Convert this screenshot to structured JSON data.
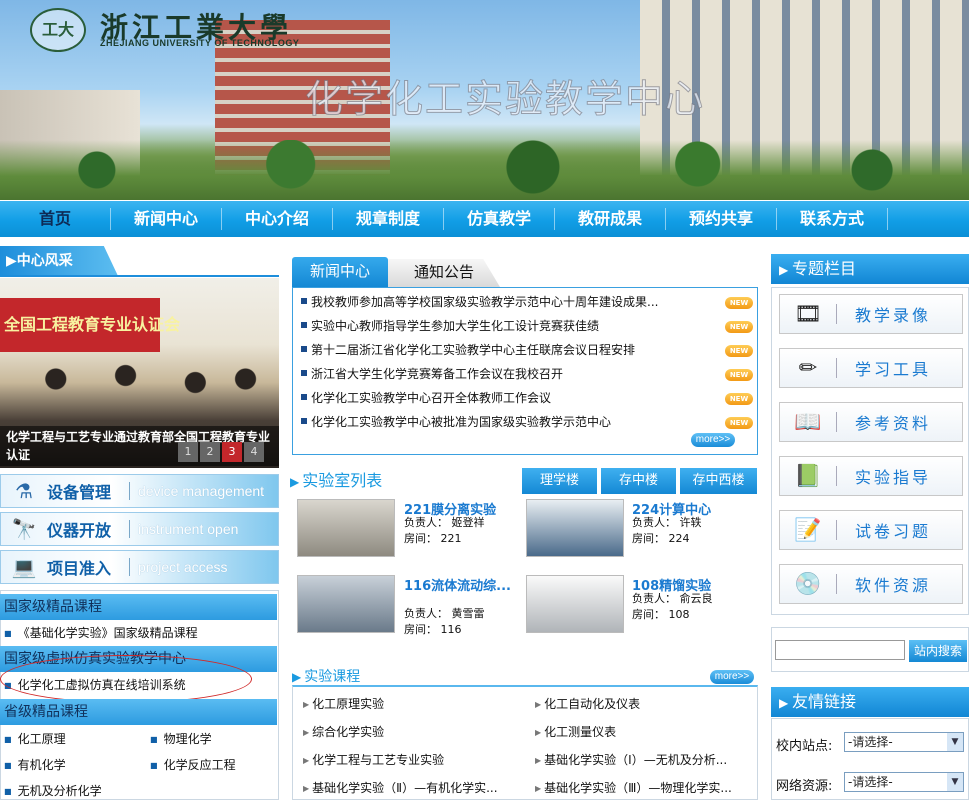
{
  "header": {
    "logo_seal": "工大",
    "logo_name": "浙江工業大學",
    "logo_en": "ZHEJIANG UNIVERSITY OF TECHNOLOGY",
    "site_title": "化学化工实验教学中心"
  },
  "nav": [
    "首页",
    "新闻中心",
    "中心介绍",
    "规章制度",
    "仿真教学",
    "教研成果",
    "预约共享",
    "联系方式"
  ],
  "feature": {
    "tab": "中心风采",
    "banner_text": "全国工程教育专业认证会",
    "caption": "化学工程与工艺专业通过教育部全国工程教育专业认证",
    "pages": [
      "1",
      "2",
      "3",
      "4"
    ],
    "active_page": "3"
  },
  "left_buttons": [
    {
      "label": "设备管理",
      "en": "device management",
      "icon": "flask-icon",
      "glyph": "⚗"
    },
    {
      "label": "仪器开放",
      "en": "instrument open",
      "icon": "telescope-icon",
      "glyph": "🔭"
    },
    {
      "label": "项目准入",
      "en": "project access",
      "icon": "laptop-icon",
      "glyph": "💻"
    }
  ],
  "left_sections": {
    "national_course": {
      "title": "国家级精品课程",
      "links": [
        "《基础化学实验》国家级精品课程"
      ]
    },
    "virtual_center": {
      "title": "国家级虚拟仿真实验教学中心",
      "links": [
        "化学化工虚拟仿真在线培训系统"
      ]
    },
    "provincial_course": {
      "title": "省级精品课程",
      "links": [
        "化工原理",
        "物理化学",
        "有机化学",
        "化学反应工程",
        "无机及分析化学"
      ]
    }
  },
  "news": {
    "tab_active": "新闻中心",
    "tab_other": "通知公告",
    "badge": "NEW",
    "more": "more>>",
    "items": [
      "我校教师参加高等学校国家级实验教学示范中心十周年建设成果...",
      "实验中心教师指导学生参加大学生化工设计竞赛获佳绩",
      "第十二届浙江省化学化工实验教学中心主任联席会议日程安排",
      "浙江省大学生化学竞赛筹备工作会议在我校召开",
      "化学化工实验教学中心召开全体教师工作会议",
      "化学化工实验教学中心被批准为国家级实验教学示范中心"
    ]
  },
  "labs": {
    "title": "实验室列表",
    "buildings": [
      "理学楼",
      "存中楼",
      "存中西楼"
    ],
    "owner_label": "负责人：",
    "room_label": "房间：",
    "items": [
      {
        "name": "221膜分离实验",
        "owner": "姬登祥",
        "room": "221"
      },
      {
        "name": "224计算中心",
        "owner": "许轶",
        "room": "224"
      },
      {
        "name": "116流体流动综...",
        "owner": "黄雪雷",
        "room": "116"
      },
      {
        "name": "108精馏实验",
        "owner": "俞云良",
        "room": "108"
      }
    ]
  },
  "courses": {
    "title": "实验课程",
    "more": "more>>",
    "items": [
      "化工原理实验",
      "化工自动化及仪表",
      "综合化学实验",
      "化工测量仪表",
      "化学工程与工艺专业实验",
      "基础化学实验（Ⅰ）—无机及分析...",
      "基础化学实验（Ⅱ）—有机化学实...",
      "基础化学实验（Ⅲ）—物理化学实..."
    ]
  },
  "topics": {
    "title": "专题栏目",
    "items": [
      {
        "label": "教学录像",
        "icon": "film-reel-icon",
        "glyph": "🎞"
      },
      {
        "label": "学习工具",
        "icon": "pencil-ruler-icon",
        "glyph": "✏"
      },
      {
        "label": "参考资料",
        "icon": "book-icon",
        "glyph": "📖"
      },
      {
        "label": "实验指导",
        "icon": "chalkboard-icon",
        "glyph": "📗"
      },
      {
        "label": "试卷习题",
        "icon": "exam-paper-icon",
        "glyph": "📝"
      },
      {
        "label": "软件资源",
        "icon": "disc-icon",
        "glyph": "💿"
      }
    ]
  },
  "search": {
    "button": "站内搜索",
    "value": ""
  },
  "links": {
    "title": "友情链接",
    "rows": [
      {
        "label": "校内站点:",
        "value": "-请选择-"
      },
      {
        "label": "网络资源:",
        "value": "-请选择-"
      }
    ]
  },
  "colors": {
    "nav": "#119ee6",
    "accent": "#1a9ae0",
    "link": "#1a7ad0",
    "highlight": "#d02a2a"
  }
}
